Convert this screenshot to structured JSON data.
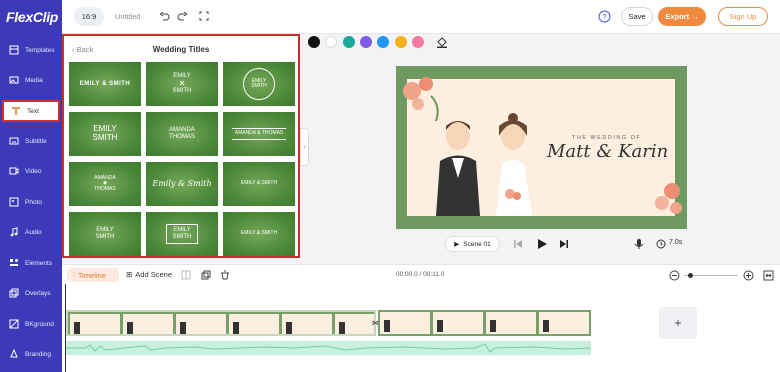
{
  "app": {
    "logo_text": "FlexClip"
  },
  "sidebar": {
    "items": [
      {
        "label": "Templates",
        "icon": "templates-icon"
      },
      {
        "label": "Media",
        "icon": "media-icon"
      },
      {
        "label": "Text",
        "icon": "text-icon",
        "active": true
      },
      {
        "label": "Subtitle",
        "icon": "subtitle-icon"
      },
      {
        "label": "Video",
        "icon": "video-icon"
      },
      {
        "label": "Photo",
        "icon": "photo-icon"
      },
      {
        "label": "Audio",
        "icon": "audio-icon"
      },
      {
        "label": "Elements",
        "icon": "elements-icon"
      },
      {
        "label": "Overlays",
        "icon": "overlays-icon"
      },
      {
        "label": "BKground",
        "icon": "background-icon"
      },
      {
        "label": "Branding",
        "icon": "branding-icon"
      }
    ]
  },
  "topbar": {
    "aspect_ratio": "16:9",
    "project_title": "Untitled",
    "save_label": "Save",
    "export_label": "Export →",
    "signup_label": "Sign Up"
  },
  "panel": {
    "back_label": "Back",
    "title": "Wedding Titles",
    "thumbnails": [
      {
        "lines": [
          "EMILY & SMITH"
        ]
      },
      {
        "lines": [
          "EMILY",
          "SMITH"
        ]
      },
      {
        "lines": [
          "EMILY",
          "SMITH"
        ]
      },
      {
        "lines": [
          "EMILY",
          "SMITH"
        ]
      },
      {
        "lines": [
          "AMANDA",
          "THOMAS"
        ]
      },
      {
        "lines": [
          "AMANDA & THOMAS"
        ]
      },
      {
        "lines": [
          "AMANDA",
          "THOMAS"
        ]
      },
      {
        "lines": [
          "Emily & Smith"
        ]
      },
      {
        "lines": [
          "EMILY & SMITH"
        ]
      },
      {
        "lines": [
          "EMILY",
          "SMITH"
        ]
      },
      {
        "lines": [
          "EMILY",
          "SMITH"
        ]
      },
      {
        "lines": [
          "EMILY & SMITH"
        ]
      }
    ]
  },
  "colors": [
    "#111111",
    "#ffffff",
    "#1aa89a",
    "#7c5ce0",
    "#2196f3",
    "#f5b21c",
    "#f07aa0"
  ],
  "canvas": {
    "subtitle": "THE WEDDING OF",
    "names": "Matt & Karin"
  },
  "player": {
    "scene_label": "Scene 01",
    "duration": "7.0s"
  },
  "timeline": {
    "tab_label": "Timeline",
    "add_scene_label": "Add Scene",
    "timecode": "00:00.0 / 00:11.0"
  }
}
